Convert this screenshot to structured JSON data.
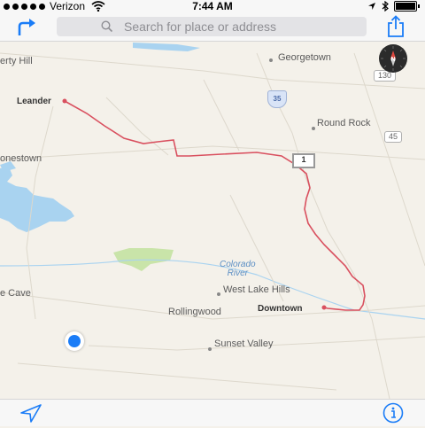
{
  "status_bar": {
    "carrier": "Verizon",
    "time": "7:44 AM"
  },
  "search": {
    "placeholder": "Search for place or address"
  },
  "map": {
    "places": {
      "georgetown": "Georgetown",
      "leander": "Leander",
      "round_rock": "Round Rock",
      "cedar_park_partial": "erty Hill",
      "jonestown_partial": "onestown",
      "cave_partial": "e Cave",
      "west_lake_hills": "West Lake Hills",
      "rollingwood": "Rollingwood",
      "downtown": "Downtown",
      "sunset_valley": "Sunset Valley",
      "colorado_river_1": "Colorado",
      "colorado_river_2": "River"
    },
    "road_shields": {
      "s130": "130",
      "i35": "35",
      "s45": "45",
      "us1": "1"
    },
    "route_color": "#d9505f",
    "user_location_color": "#1a7cf7"
  },
  "toolbar": {
    "accent_color": "#1a7cf7"
  }
}
